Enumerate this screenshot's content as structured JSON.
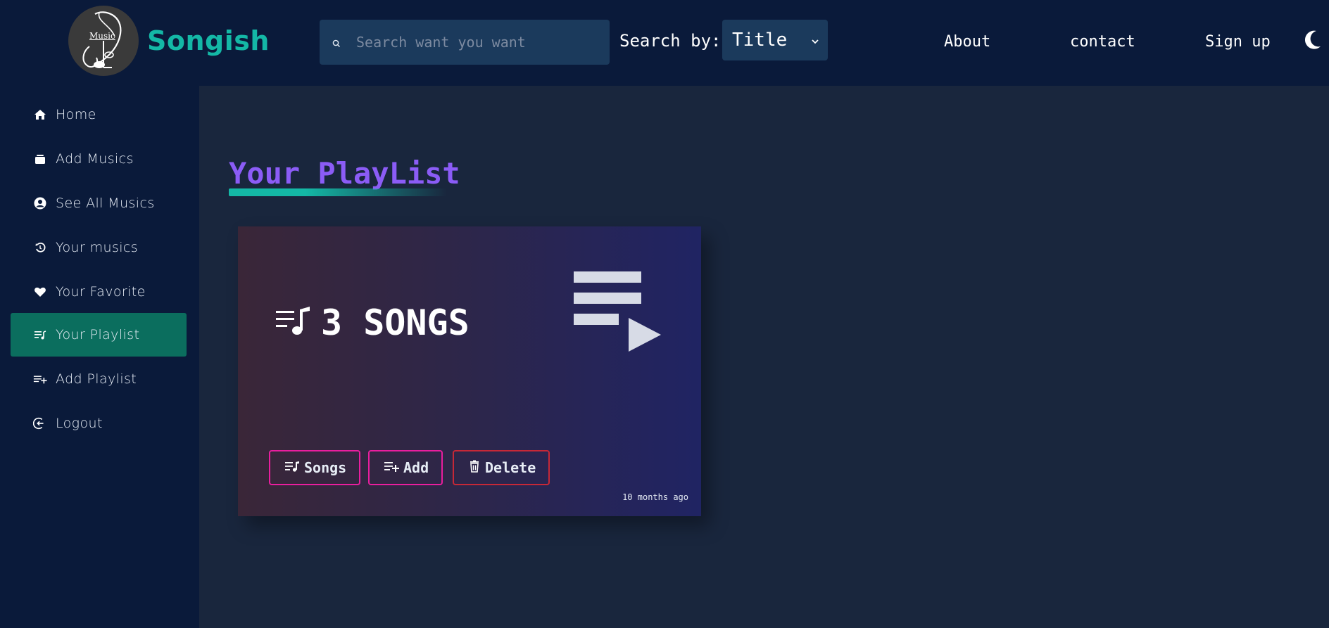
{
  "header": {
    "logo_text": "Music",
    "brand": "Songish",
    "search": {
      "placeholder": "Search want you want"
    },
    "search_by_label": "Search by:",
    "search_by_value": "Title",
    "nav": [
      {
        "label": "About"
      },
      {
        "label": "contact"
      },
      {
        "label": "Sign up"
      }
    ],
    "theme_icon": "moon-icon"
  },
  "sidebar": {
    "items": [
      {
        "label": "Home",
        "icon": "home-icon"
      },
      {
        "label": "Add Musics",
        "icon": "box-icon"
      },
      {
        "label": "See All Musics",
        "icon": "user-circle-icon"
      },
      {
        "label": "Your musics",
        "icon": "history-icon"
      },
      {
        "label": "Your Favorite",
        "icon": "heart-icon"
      },
      {
        "label": "Your Playlist",
        "icon": "playlist-icon",
        "active": true
      },
      {
        "label": "Add Playlist",
        "icon": "playlist-add-icon"
      },
      {
        "label": "Logout",
        "icon": "logout-icon"
      }
    ]
  },
  "main": {
    "title": "Your PlayList",
    "card": {
      "count_label": "3 SONGS",
      "buttons": [
        {
          "label": "Songs",
          "icon": "playlist-icon"
        },
        {
          "label": "Add",
          "icon": "playlist-add-icon"
        },
        {
          "label": "Delete",
          "icon": "trash-icon"
        }
      ],
      "time": "10 months ago"
    }
  },
  "colors": {
    "brand": "#14b8a6",
    "title": "#8b5cf6",
    "active_nav": "#0b6e5e",
    "button_border": "#e91e9e",
    "delete_border": "#c62837"
  }
}
